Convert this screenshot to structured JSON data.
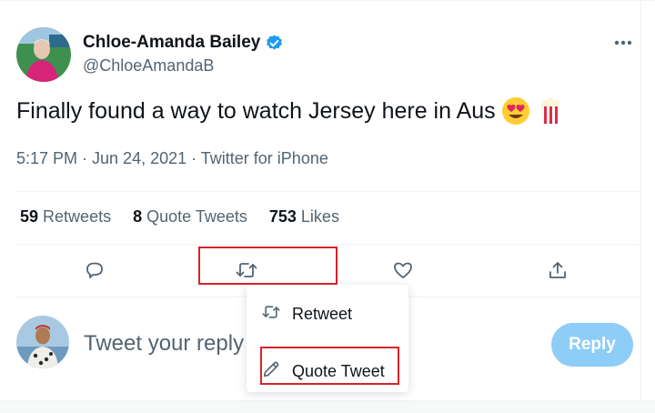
{
  "author": {
    "name": "Chloe-Amanda Bailey",
    "handle": "@ChloeAmandaB",
    "verified_icon": "verified-badge-icon"
  },
  "tweet": {
    "text": "Finally found a way to watch Jersey here in Aus",
    "emojis": [
      "heart-eyes-emoji",
      "popcorn-emoji"
    ],
    "meta": "5:17 PM · Jun 24, 2021 · Twitter for iPhone"
  },
  "stats": [
    {
      "count": "59",
      "label": "Retweets"
    },
    {
      "count": "8",
      "label": "Quote Tweets"
    },
    {
      "count": "753",
      "label": "Likes"
    }
  ],
  "actions": [
    "reply-icon",
    "retweet-icon",
    "like-icon",
    "share-icon"
  ],
  "retweet_menu": {
    "retweet_label": "Retweet",
    "quote_label": "Quote Tweet"
  },
  "reply": {
    "placeholder": "Tweet your reply",
    "button_label": "Reply"
  },
  "colors": {
    "accent": "#1d9bf0",
    "reply_button_disabled": "#8ecdf8",
    "highlight": "#d9222a",
    "secondary_text": "#536471"
  }
}
